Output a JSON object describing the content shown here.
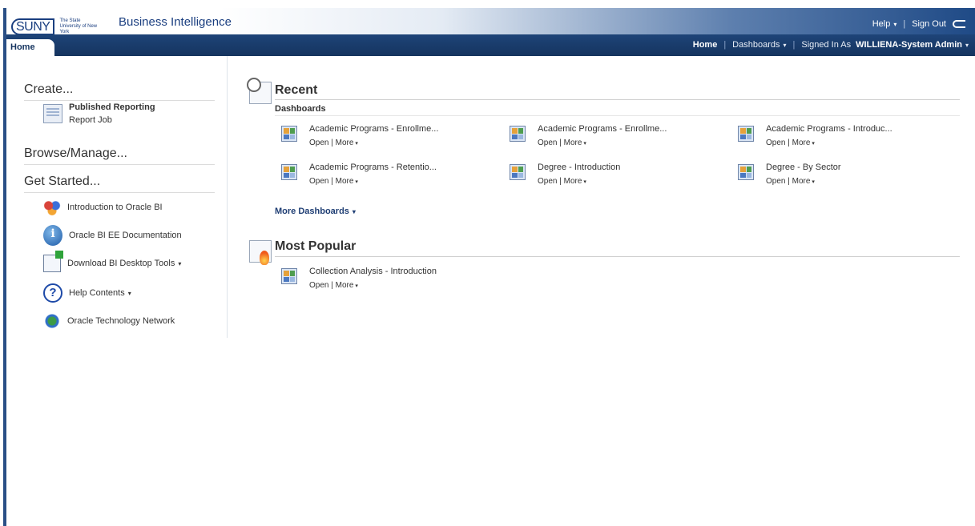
{
  "header": {
    "logo_text": "SUNY",
    "logo_subtext": "The State University of New York",
    "app_title": "Business Intelligence",
    "help_label": "Help",
    "signout_label": "Sign Out"
  },
  "nav": {
    "home_tab": "Home",
    "home_link": "Home",
    "dashboards_label": "Dashboards",
    "signed_in_prefix": "Signed In As",
    "user_name": "WILLIENA-System Admin"
  },
  "left": {
    "create_heading": "Create...",
    "create_items": [
      "Published Reporting",
      "Report Job"
    ],
    "browse_heading": "Browse/Manage...",
    "started_heading": "Get Started...",
    "started_items": [
      {
        "label": "Introduction to Oracle BI",
        "icon": "oracle-bi-intro-icon"
      },
      {
        "label": "Oracle BI EE Documentation",
        "icon": "info-icon"
      },
      {
        "label": "Download BI Desktop Tools",
        "icon": "download-icon"
      },
      {
        "label": "Help Contents",
        "icon": "help-icon"
      },
      {
        "label": "Oracle Technology Network",
        "icon": "globe-network-icon"
      }
    ]
  },
  "main": {
    "recent_heading": "Recent",
    "dashboards_subheading": "Dashboards",
    "recent_dashboards": [
      {
        "name": "Academic Programs - Enrollme..."
      },
      {
        "name": "Academic Programs - Enrollme..."
      },
      {
        "name": "Academic Programs - Introduc..."
      },
      {
        "name": "Academic Programs - Retentio..."
      },
      {
        "name": "Degree - Introduction"
      },
      {
        "name": "Degree - By Sector"
      }
    ],
    "open_label": "Open",
    "more_label": "More",
    "more_dashboards": "More Dashboards",
    "popular_heading": "Most Popular",
    "popular_items": [
      {
        "name": "Collection Analysis - Introduction"
      }
    ]
  },
  "colors": {
    "brand_blue": "#1b3f80",
    "navbar": "#1e4478"
  }
}
